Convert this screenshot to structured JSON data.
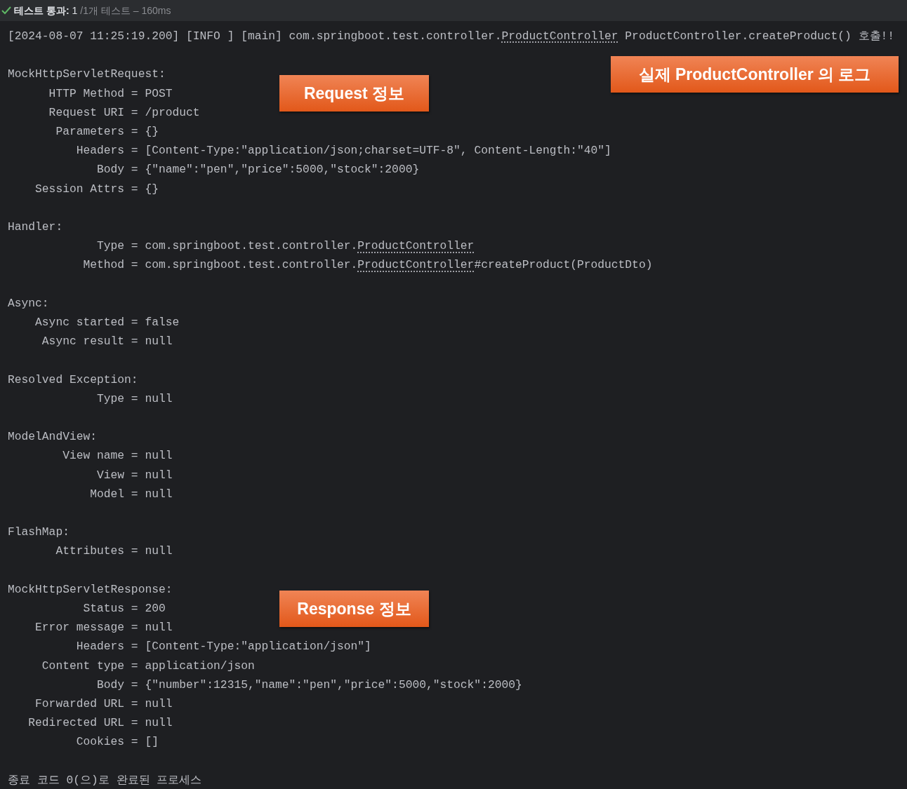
{
  "status": {
    "passed": true,
    "label": "테스트 통과:",
    "count": "1",
    "detail": "/1개 테스트 – 160ms"
  },
  "blocks": [
    {
      "lines": [
        {
          "segments": [
            {
              "text": "[2024-08-07 11:25:19.200] [INFO ] [main] com.springboot.test.controller.",
              "underlined": false
            },
            {
              "text": "ProductController",
              "underlined": true
            },
            {
              "text": " ProductController.createProduct() 호출!!",
              "underlined": false
            }
          ]
        }
      ]
    },
    {
      "callouts": [
        {
          "text": "Request 정보",
          "kind": "middle"
        },
        {
          "text": "실제 ProductController 의 로그",
          "kind": "right"
        }
      ],
      "lines": [
        {
          "segments": [
            {
              "text": "MockHttpServletRequest:",
              "underlined": false
            }
          ]
        },
        {
          "segments": [
            {
              "text": "HTTP Method = POST",
              "underlined": false
            }
          ]
        },
        {
          "segments": [
            {
              "text": "Request URI = /product",
              "underlined": false
            }
          ]
        },
        {
          "segments": [
            {
              "text": "Parameters = {}",
              "underlined": false
            }
          ]
        },
        {
          "segments": [
            {
              "text": "Headers = [Content-Type:\"application/json;charset=UTF-8\", Content-Length:\"40\"]",
              "underlined": false
            }
          ]
        },
        {
          "segments": [
            {
              "text": "Body = {\"name\":\"pen\",\"price\":5000,\"stock\":2000}",
              "underlined": false
            }
          ]
        },
        {
          "segments": [
            {
              "text": "Session Attrs = {}",
              "underlined": false
            }
          ]
        }
      ]
    },
    {
      "lines": [
        {
          "segments": [
            {
              "text": "Handler:",
              "underlined": false
            }
          ]
        },
        {
          "segments": [
            {
              "text": "Type = com.springboot.test.controller.",
              "underlined": false
            },
            {
              "text": "ProductController",
              "underlined": true
            }
          ]
        },
        {
          "segments": [
            {
              "text": "Method = com.springboot.test.controller.",
              "underlined": false
            },
            {
              "text": "ProductController",
              "underlined": true
            },
            {
              "text": "#createProduct(ProductDto)",
              "underlined": false
            }
          ]
        }
      ]
    },
    {
      "lines": [
        {
          "segments": [
            {
              "text": "Async:",
              "underlined": false
            }
          ]
        },
        {
          "segments": [
            {
              "text": "Async started = false",
              "underlined": false
            }
          ]
        },
        {
          "segments": [
            {
              "text": "Async result = null",
              "underlined": false
            }
          ]
        }
      ]
    },
    {
      "lines": [
        {
          "segments": [
            {
              "text": "Resolved Exception:",
              "underlined": false
            }
          ]
        },
        {
          "segments": [
            {
              "text": "Type = null",
              "underlined": false
            }
          ]
        }
      ]
    },
    {
      "lines": [
        {
          "segments": [
            {
              "text": "ModelAndView:",
              "underlined": false
            }
          ]
        },
        {
          "segments": [
            {
              "text": "View name = null",
              "underlined": false
            }
          ]
        },
        {
          "segments": [
            {
              "text": "View = null",
              "underlined": false
            }
          ]
        },
        {
          "segments": [
            {
              "text": "Model = null",
              "underlined": false
            }
          ]
        }
      ]
    },
    {
      "lines": [
        {
          "segments": [
            {
              "text": "FlashMap:",
              "underlined": false
            }
          ]
        },
        {
          "segments": [
            {
              "text": "Attributes = null",
              "underlined": false
            }
          ]
        }
      ]
    },
    {
      "callouts": [
        {
          "text": "Response 정보",
          "kind": "middle"
        }
      ],
      "lines": [
        {
          "segments": [
            {
              "text": "MockHttpServletResponse:",
              "underlined": false
            }
          ]
        },
        {
          "segments": [
            {
              "text": "Status = 200",
              "underlined": false
            }
          ]
        },
        {
          "segments": [
            {
              "text": "Error message = null",
              "underlined": false
            }
          ]
        },
        {
          "segments": [
            {
              "text": "Headers = [Content-Type:\"application/json\"]",
              "underlined": false
            }
          ]
        },
        {
          "segments": [
            {
              "text": "Content type = application/json",
              "underlined": false
            }
          ]
        },
        {
          "segments": [
            {
              "text": "Body = {\"number\":12315,\"name\":\"pen\",\"price\":5000,\"stock\":2000}",
              "underlined": false
            }
          ]
        },
        {
          "segments": [
            {
              "text": "Forwarded URL = null",
              "underlined": false
            }
          ]
        },
        {
          "segments": [
            {
              "text": "Redirected URL = null",
              "underlined": false
            }
          ]
        },
        {
          "segments": [
            {
              "text": "Cookies = []",
              "underlined": false
            }
          ]
        }
      ]
    },
    {
      "lines": [
        {
          "segments": [
            {
              "text": "종료 코드 0(으)로 완료된 프로세스",
              "underlined": false
            }
          ]
        }
      ]
    }
  ]
}
